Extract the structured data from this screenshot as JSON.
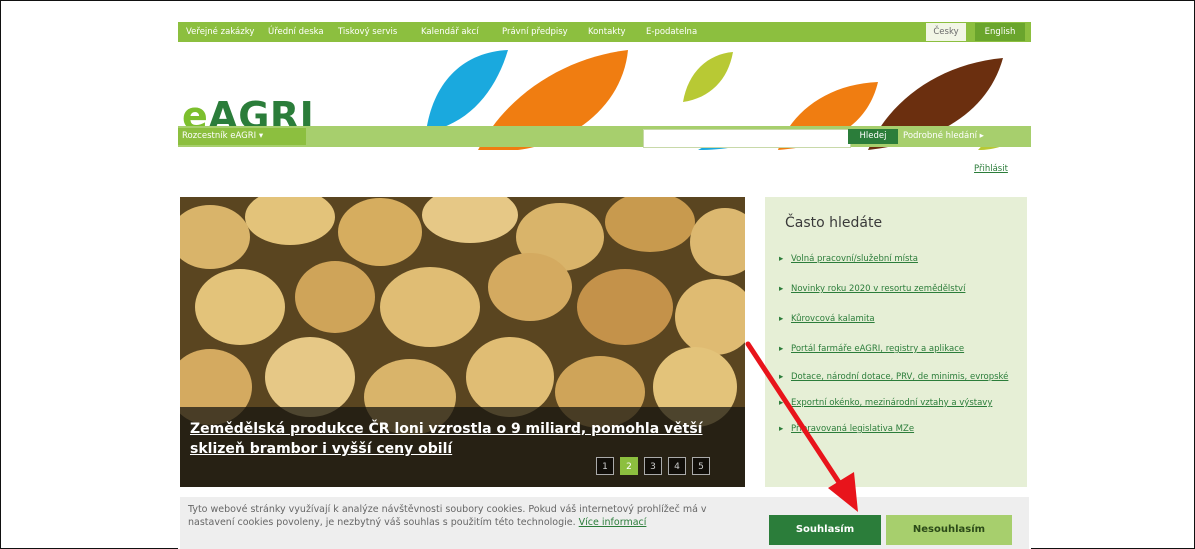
{
  "topnav": {
    "items": [
      "Veřejné zakázky",
      "Úřední deska",
      "Tiskový servis",
      "Kalendář akcí",
      "Právní předpisy",
      "Kontakty",
      "E-podatelna"
    ],
    "lang_cz": "Česky",
    "lang_en": "English"
  },
  "logo": {
    "prefix": "e",
    "name": "AGRI"
  },
  "searchbar": {
    "rozcestnik": "Rozcestník eAGRI ▾",
    "search_value": "",
    "search_button": "Hledej",
    "advanced": "Podrobné hledání ▸"
  },
  "login": "Přihlásit",
  "hero": {
    "headline": "Zemědělská produkce ČR loni vzrostla o 9 miliard, pomohla větší sklizeň brambor i vyšší ceny obilí",
    "pager": [
      "1",
      "2",
      "3",
      "4",
      "5"
    ],
    "active_page": "2"
  },
  "sidebar": {
    "title": "Často hledáte",
    "links": [
      "Volná pracovní/služební místa",
      "Novinky roku 2020 v resortu zemědělství",
      "Kůrovcová kalamita",
      "Portál farmáře eAGRI, registry a aplikace",
      "Dotace, národní dotace, PRV, de minimis, evropské",
      "Exportní okénko, mezinárodní vztahy a výstavy",
      "Připravovaná legislativa MZe"
    ]
  },
  "cookie": {
    "text": "Tyto webové stránky využívají k analýze návštěvnosti soubory cookies. Pokud váš internetový prohlížeč má v nastavení cookies povoleny, je nezbytný váš souhlas s použitím této technologie.",
    "more": "Více informací",
    "accept": "Souhlasím",
    "decline": "Nesouhlasím"
  },
  "colors": {
    "accent_green": "#8cbf3f",
    "dark_green": "#2b7d3a",
    "annotation_arrow": "#e8141b"
  }
}
